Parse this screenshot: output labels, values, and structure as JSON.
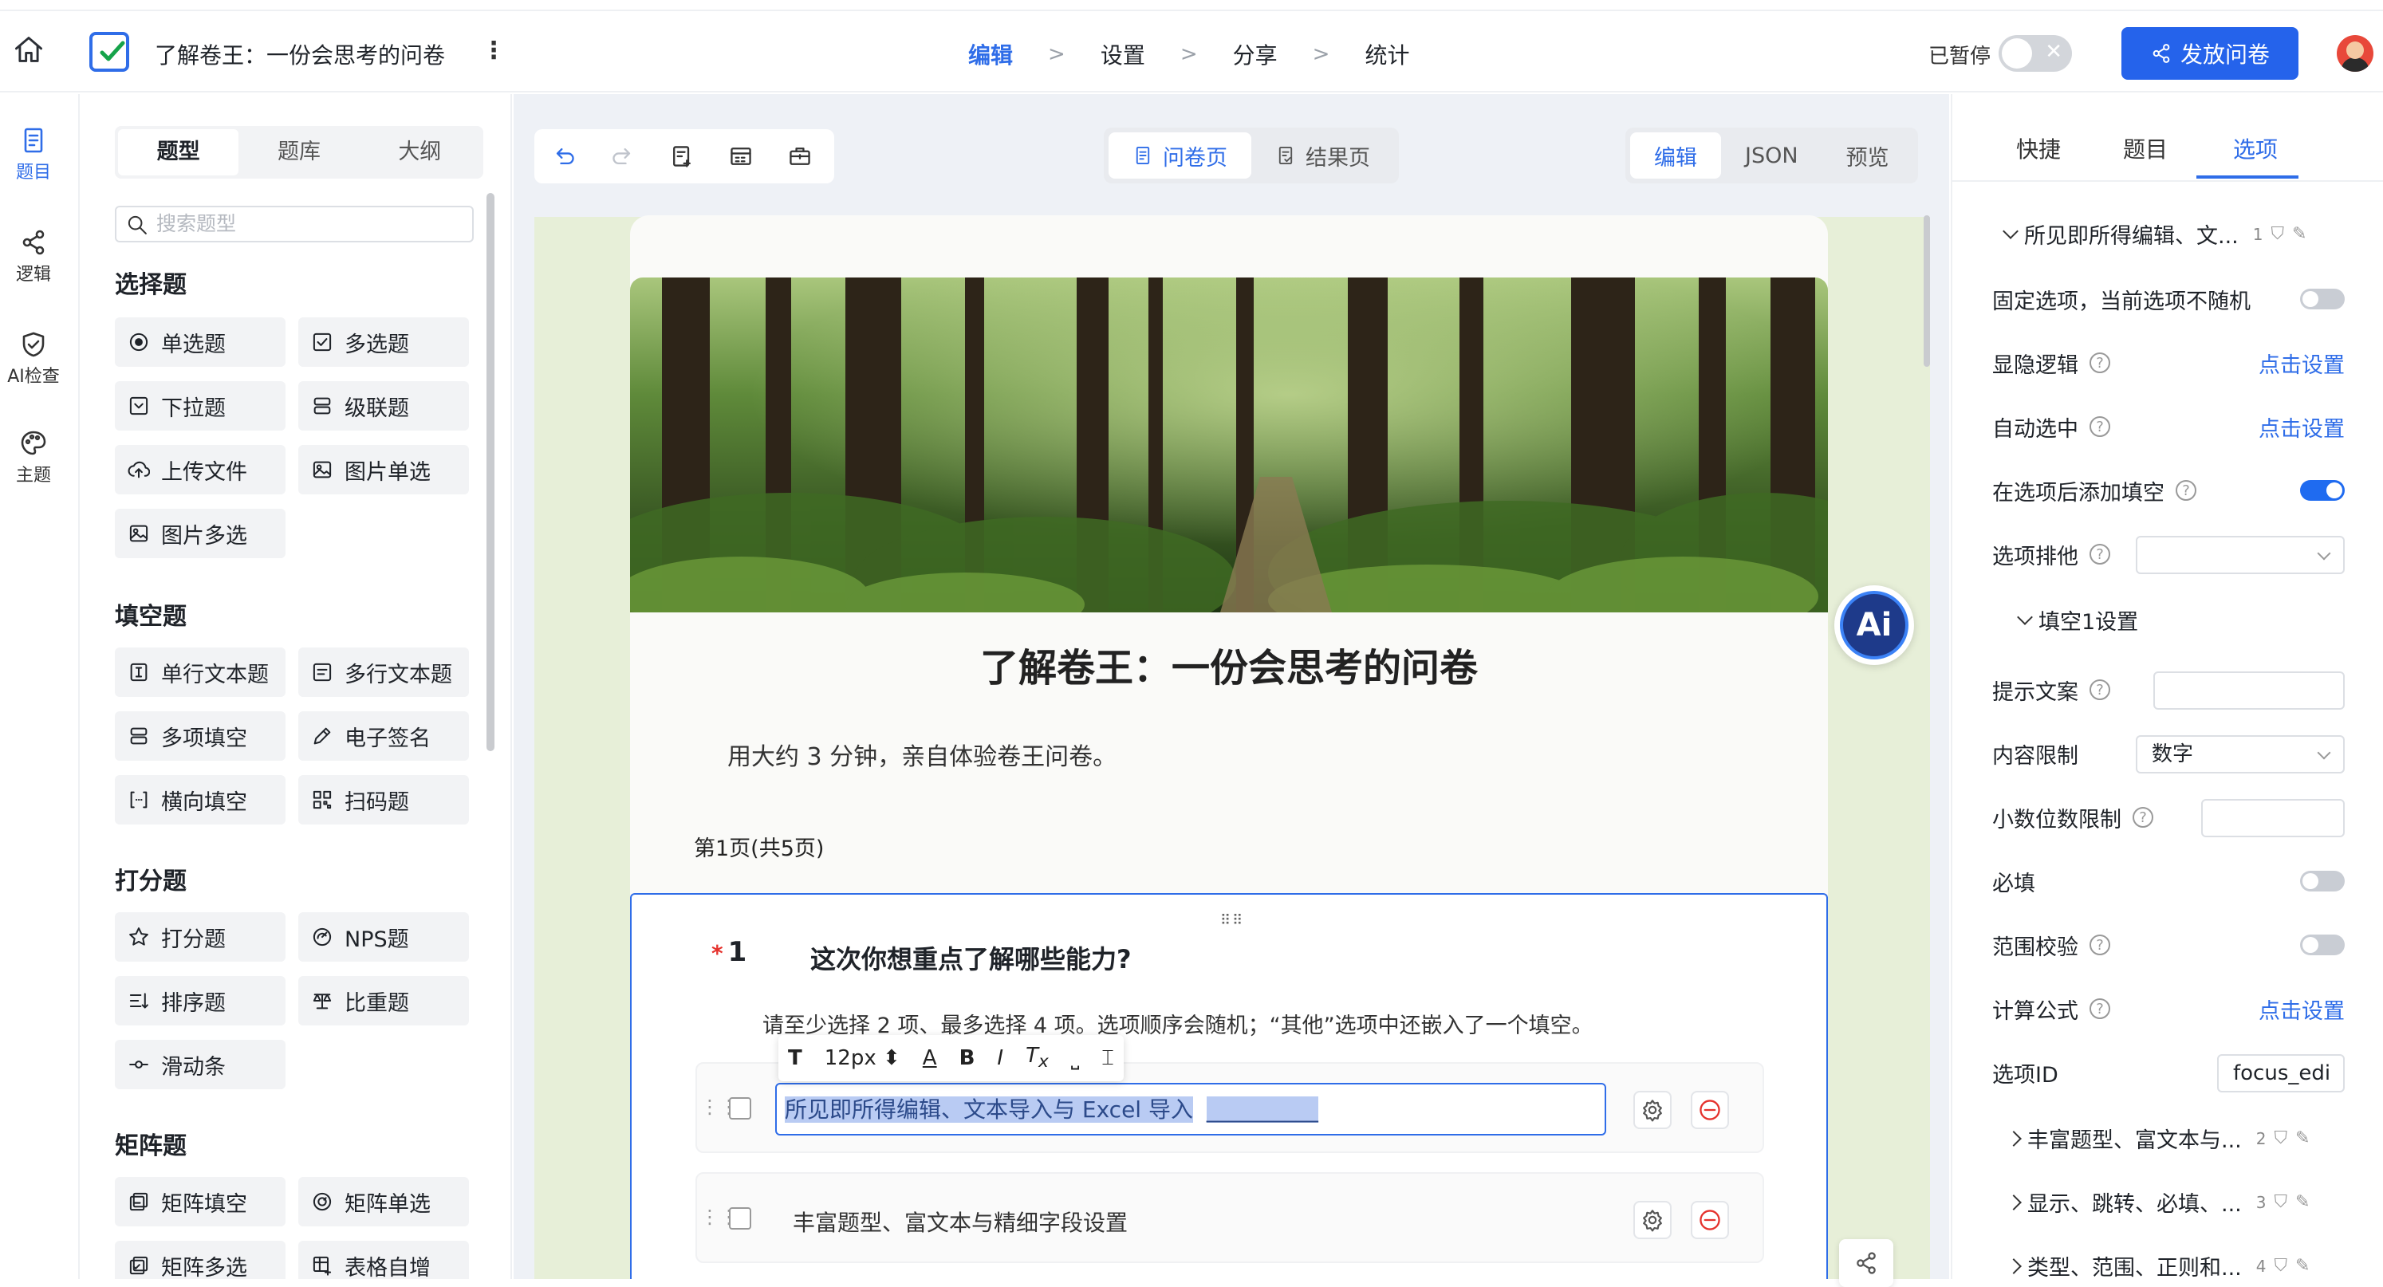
{
  "header": {
    "title": "了解卷王：一份会思考的问卷",
    "steps": [
      "编辑",
      "设置",
      "分享",
      "统计"
    ],
    "step_arrow": ">",
    "paused_label": "已暂停",
    "paused_toggle_glyph": "✕",
    "publish_label": "发放问卷"
  },
  "rail": {
    "items": [
      {
        "label": "题目",
        "icon": "document-icon"
      },
      {
        "label": "逻辑",
        "icon": "share-icon"
      },
      {
        "label": "AI检查",
        "icon": "shield-check-icon"
      },
      {
        "label": "主题",
        "icon": "palette-icon"
      }
    ]
  },
  "palette": {
    "tabs": [
      "题型",
      "题库",
      "大纲"
    ],
    "search_placeholder": "搜索题型",
    "groups": [
      {
        "title": "选择题",
        "items": [
          "单选题",
          "多选题",
          "下拉题",
          "级联题",
          "上传文件",
          "图片单选",
          "图片多选"
        ]
      },
      {
        "title": "填空题",
        "items": [
          "单行文本题",
          "多行文本题",
          "多项填空",
          "电子签名",
          "横向填空",
          "扫码题"
        ]
      },
      {
        "title": "打分题",
        "items": [
          "打分题",
          "NPS题",
          "排序题",
          "比重题",
          "滑动条"
        ]
      },
      {
        "title": "矩阵题",
        "items": [
          "矩阵填空",
          "矩阵单选",
          "矩阵多选",
          "表格自增"
        ]
      }
    ]
  },
  "center": {
    "page_tabs": [
      "问卷页",
      "结果页"
    ],
    "mode_tabs": [
      "编辑",
      "JSON",
      "预览"
    ],
    "survey": {
      "title": "了解卷王：一份会思考的问卷",
      "description": "用大约 3 分钟，亲自体验卷王问卷。",
      "page_info": "第1页(共5页)"
    },
    "question": {
      "required_mark": "*",
      "number": "1",
      "text": "这次你想重点了解哪些能力?",
      "hint": "请至少选择 2 项、最多选择 4 项。选项顺序会随机；“其他”选项中还嵌入了一个填空。",
      "toolbar": {
        "font_size": "12px"
      },
      "options": [
        {
          "text": "所见即所得编辑、文本导入与 Excel 导入",
          "blank": "__________"
        },
        {
          "text": "丰富题型、富文本与精细字段设置"
        }
      ]
    },
    "ai_label": "Ai"
  },
  "right": {
    "tabs": [
      "快捷",
      "题目",
      "选项"
    ],
    "option_sections": [
      {
        "title": "所见即所得编辑、文...",
        "num": "1"
      },
      {
        "title": "丰富题型、富文本与...",
        "num": "2"
      },
      {
        "title": "显示、跳转、必填、...",
        "num": "3"
      },
      {
        "title": "类型、范围、正则和...",
        "num": "4"
      }
    ],
    "rows": {
      "fixed": "固定选项，当前选项不随机",
      "visibility": "显隐逻辑",
      "autoselect": "自动选中",
      "addblank": "在选项后添加填空",
      "exclusive": "选项排他",
      "blank_settings": "填空1设置",
      "placeholder": "提示文案",
      "content_limit": "内容限制",
      "content_limit_value": "数字",
      "decimal": "小数位数限制",
      "required": "必填",
      "range": "范围校验",
      "formula": "计算公式",
      "option_id": "选项ID",
      "option_id_value": "focus_edi",
      "set_link": "点击设置"
    }
  },
  "colors": {
    "accent": "#2f6de8",
    "publish": "#2563eb",
    "required": "#e5322d"
  }
}
